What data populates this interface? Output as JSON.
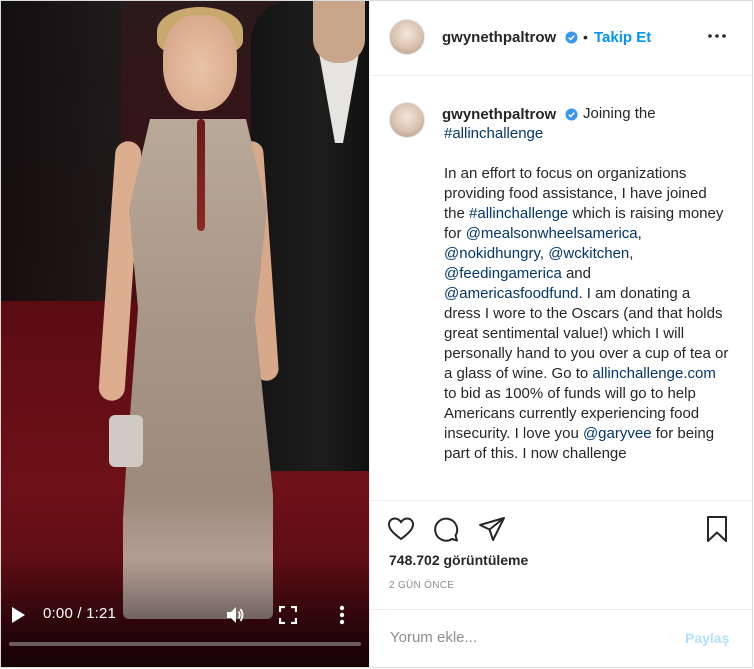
{
  "video": {
    "time": "0:00 / 1:21",
    "progress": 0.0
  },
  "post": {
    "username": "gwynethpaltrow",
    "follow_label": "Takip Et",
    "separator": "•",
    "caption": {
      "p1_text_a": "Joining the",
      "p1_tag": "#allinchallenge",
      "p2_a": "In an effort to focus on organizations providing food assistance, I have joined the ",
      "p2_tag": "#allinchallenge",
      "p2_b": " which is raising money for ",
      "m1": "@mealsonwheelsamerica",
      "m2": "@nokidhungry",
      "m3": "@wckitchen",
      "m4": "@feedingamerica",
      "and": " and ",
      "m5": "@americasfoodfund",
      "p2_c": ". I am donating a dress I wore to the Oscars (and that holds great sentimental value!) which I will personally hand to you over a cup of tea or a glass of wine. Go to ",
      "link": "allinchallenge.com",
      "p2_d": " to bid as 100% of funds will go to help Americans currently experiencing food insecurity. I love you ",
      "m6": "@garyvee",
      "p2_e": " for being part of this. I now challenge"
    },
    "views": "748.702 görüntüleme",
    "time_ago": "2 GÜN ÖNCE",
    "comment_placeholder": "Yorum ekle...",
    "share_label": "Paylaş"
  },
  "colors": {
    "accent": "#0095f6",
    "link": "#00376b",
    "muted": "#8e8e8e",
    "share_disabled": "#b2dffc"
  }
}
